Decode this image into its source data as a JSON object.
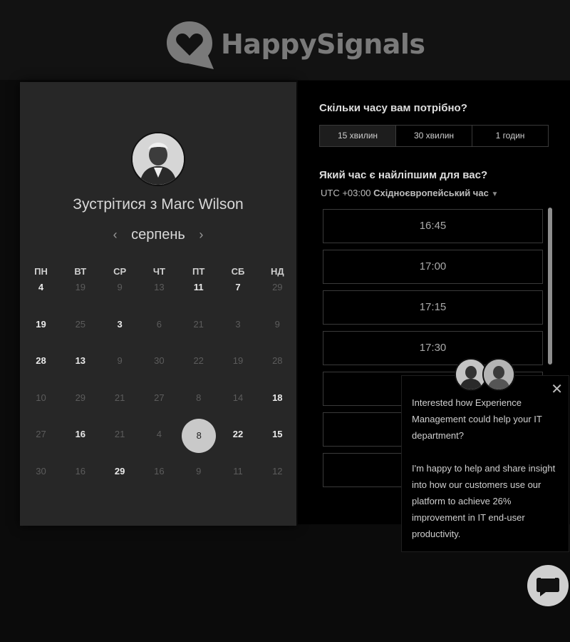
{
  "brand": {
    "name": "HappySignals"
  },
  "host": {
    "meet_label": "Зустрітися з Marc Wilson"
  },
  "calendar": {
    "month": "серпень",
    "weekdays": [
      "ПН",
      "ВТ",
      "СР",
      "ЧТ",
      "ПТ",
      "СБ",
      "НД"
    ],
    "rows": [
      [
        [
          "4",
          "on"
        ],
        [
          "19",
          "off"
        ],
        [
          "9",
          "off"
        ],
        [
          "13",
          "off"
        ],
        [
          "11",
          "on"
        ],
        [
          "7",
          "on"
        ],
        [
          "29",
          "off"
        ]
      ],
      [
        [
          "19",
          "on"
        ],
        [
          "25",
          "off"
        ],
        [
          "3",
          "on"
        ],
        [
          "6",
          "off"
        ],
        [
          "21",
          "off"
        ],
        [
          "3",
          "off"
        ],
        [
          "9",
          "off"
        ]
      ],
      [
        [
          "28",
          "on"
        ],
        [
          "13",
          "on"
        ],
        [
          "9",
          "off"
        ],
        [
          "30",
          "off"
        ],
        [
          "22",
          "off"
        ],
        [
          "19",
          "off"
        ],
        [
          "28",
          "off"
        ]
      ],
      [
        [
          "10",
          "off"
        ],
        [
          "29",
          "off"
        ],
        [
          "21",
          "off"
        ],
        [
          "27",
          "off"
        ],
        [
          "8",
          "off"
        ],
        [
          "14",
          "off"
        ],
        [
          "18",
          "on"
        ]
      ],
      [
        [
          "27",
          "off"
        ],
        [
          "16",
          "on"
        ],
        [
          "21",
          "off"
        ],
        [
          "4",
          "off"
        ],
        [
          "8",
          "sel"
        ],
        [
          "22",
          "on"
        ],
        [
          "15",
          "on"
        ]
      ],
      [
        [
          "30",
          "off"
        ],
        [
          "16",
          "off"
        ],
        [
          "29",
          "on"
        ],
        [
          "16",
          "off"
        ],
        [
          "9",
          "off"
        ],
        [
          "11",
          "off"
        ],
        [
          "12",
          "off"
        ]
      ]
    ]
  },
  "duration": {
    "question": "Скільки часу вам потрібно?",
    "options": [
      "15 хвилин",
      "30 хвилин",
      "1 годин"
    ],
    "selected_index": 0
  },
  "time": {
    "question": "Який час є найліпшим для вас?",
    "tz_offset": "UTC +03:00",
    "tz_name": "Східноєвропейський час",
    "slots": [
      "16:45",
      "17:00",
      "17:15",
      "17:30",
      "",
      "",
      "",
      ""
    ]
  },
  "chat": {
    "line1": "Interested how Experience Management could help your IT department?",
    "line2": "I'm happy to help and share insight into how our customers use our platform to achieve 26% improvement in IT end-user productivity."
  }
}
